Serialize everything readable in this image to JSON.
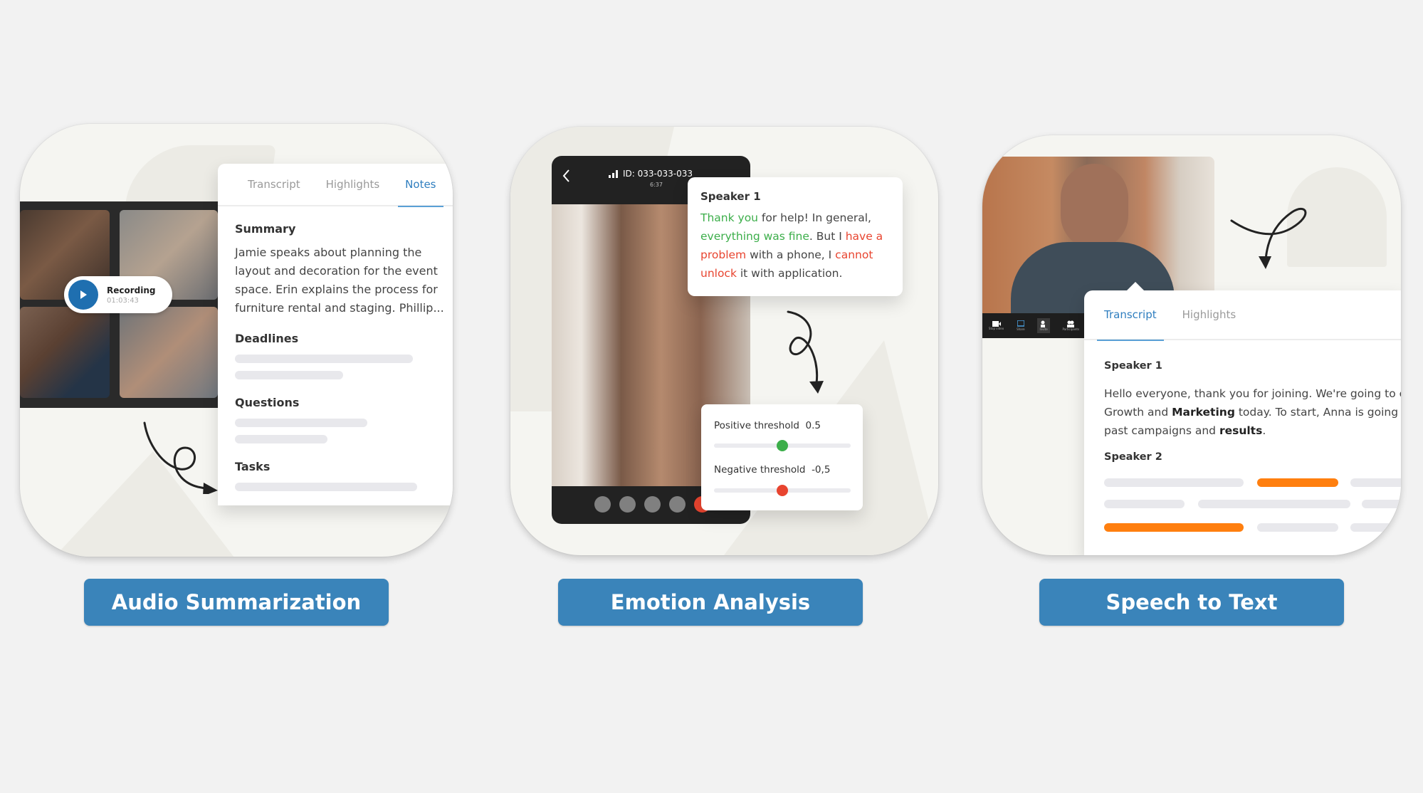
{
  "cards": [
    {
      "id": "audio-summarization",
      "recording": {
        "label": "Recording",
        "time": "01:03:43"
      },
      "tabs": [
        {
          "label": "Transcript",
          "active": false
        },
        {
          "label": "Highlights",
          "active": false
        },
        {
          "label": "Notes",
          "active": true
        }
      ],
      "summary_title": "Summary",
      "summary_text": "Jamie speaks about planning the layout and decoration for the event space. Erin explains the process for furniture rental and staging. Phillip...",
      "sections": [
        "Deadlines",
        "Questions",
        "Tasks"
      ],
      "button_label": "Audio Summarization"
    },
    {
      "id": "emotion-analysis",
      "call": {
        "id_label": "ID: 033-033-033",
        "duration": "6:37"
      },
      "speaker": "Speaker 1",
      "utterance": [
        {
          "text": "Thank you",
          "sentiment": "positive"
        },
        {
          "text": " for help! In general, ",
          "sentiment": "neutral"
        },
        {
          "text": "everything was fine",
          "sentiment": "positive"
        },
        {
          "text": ". But I ",
          "sentiment": "neutral"
        },
        {
          "text": "have a problem",
          "sentiment": "negative"
        },
        {
          "text": " with a phone, I ",
          "sentiment": "neutral"
        },
        {
          "text": "cannot unlock",
          "sentiment": "negative"
        },
        {
          "text": " it with application.",
          "sentiment": "neutral"
        }
      ],
      "thresholds": [
        {
          "label": "Positive threshold",
          "value": "0.5",
          "slider_fraction": 0.5,
          "color": "#3cae4a"
        },
        {
          "label": "Negative threshold",
          "value": "-0,5",
          "slider_fraction": 0.5,
          "color": "#e8442f"
        }
      ],
      "button_label": "Emotion Analysis"
    },
    {
      "id": "speech-to-text",
      "toolbar": [
        {
          "label": "Stop video",
          "icon": "video-camera-icon"
        },
        {
          "label": "Share",
          "icon": "share-screen-icon"
        },
        {
          "label": "Invite",
          "icon": "add-user-icon"
        },
        {
          "label": "Participants",
          "icon": "participants-icon"
        }
      ],
      "tabs": [
        {
          "label": "Transcript",
          "active": true
        },
        {
          "label": "Highlights",
          "active": false
        }
      ],
      "speaker1": "Speaker 1",
      "transcript": [
        {
          "text": "Hello everyone, thank you for joining. We're going to co",
          "bold": false
        },
        {
          "text": "Growth and ",
          "bold": false
        },
        {
          "text": "Marketing",
          "bold": true
        },
        {
          "text": " today. To start, Anna is going to",
          "bold": false
        },
        {
          "text": "past campaigns and ",
          "bold": false
        },
        {
          "text": "results",
          "bold": true
        },
        {
          "text": ".",
          "bold": false
        }
      ],
      "speaker2": "Speaker 2",
      "button_label": "Speech to Text"
    }
  ],
  "colors": {
    "accent_blue": "#3a84ba",
    "tab_active": "#2f7ebf",
    "positive": "#3cae4a",
    "negative": "#e8442f",
    "highlight_orange": "#ff7f0f"
  }
}
